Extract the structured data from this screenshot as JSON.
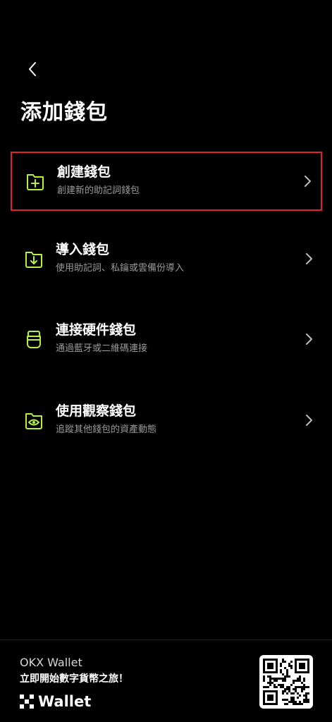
{
  "header": {
    "back_icon": "chevron-left-icon",
    "title": "添加錢包"
  },
  "options": [
    {
      "title": "創建錢包",
      "description": "創建新的助記詞錢包",
      "icon": "folder-plus-icon",
      "selected": true
    },
    {
      "title": "導入錢包",
      "description": "使用助記詞、私鑰或雲備份導入",
      "icon": "folder-download-icon",
      "selected": false
    },
    {
      "title": "連接硬件錢包",
      "description": "通過藍牙或二維碼連接",
      "icon": "hardware-wallet-icon",
      "selected": false
    },
    {
      "title": "使用觀察錢包",
      "description": "追蹤其他錢包的資產動態",
      "icon": "eye-folder-icon",
      "selected": false
    }
  ],
  "footer": {
    "brand": "OKX Wallet",
    "slogan": "立即開始數字貨幣之旅！",
    "logo_text": "Wallet",
    "qr_icon": "qr-code-icon"
  },
  "colors": {
    "background": "#000000",
    "accent": "#b5f23d",
    "selection_border": "#e0232e",
    "secondary_text": "#9a9a9a"
  }
}
